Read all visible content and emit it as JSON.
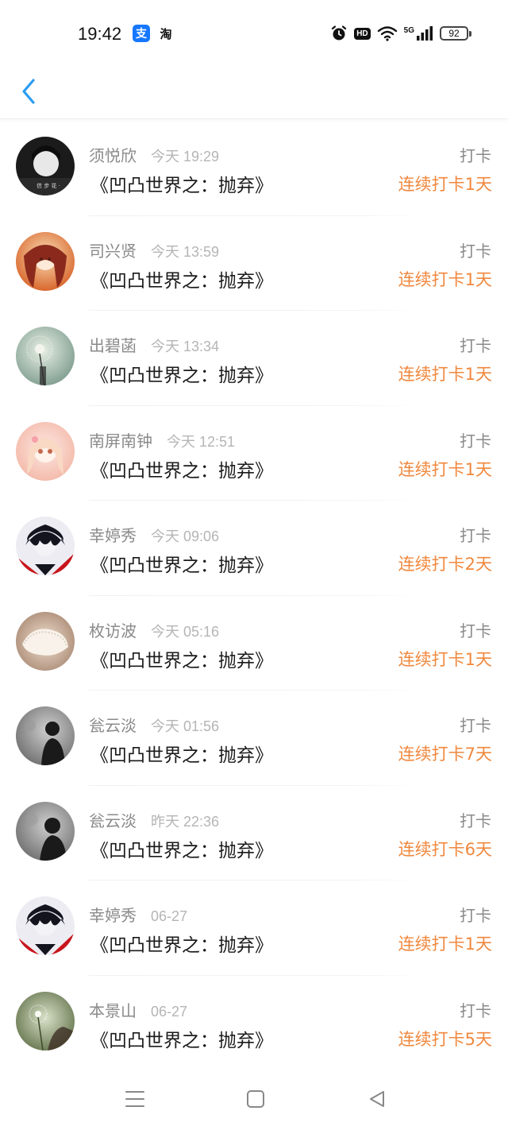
{
  "status_bar": {
    "time": "19:42",
    "app_badges": [
      {
        "icon": "alipay-icon",
        "glyph": "支",
        "color": "#1677ff"
      },
      {
        "icon": "taobao-icon",
        "glyph": "淘"
      }
    ],
    "hd_label": "HD",
    "network_label": "5G",
    "battery_level": "92"
  },
  "nav": {
    "back_icon": "chevron-left-icon",
    "accent_color": "#2c9cf2"
  },
  "theme": {
    "streak_color": "#f0883e",
    "muted_text": "#8a8a8a",
    "timestamp_text": "#b5b5b5"
  },
  "entries": [
    {
      "name": "须悦欣",
      "time": "今天 19:29",
      "book": "《凹凸世界之：抛弃》",
      "action": "打卡",
      "streak": "连续打卡1天",
      "avatar": "avatar-1"
    },
    {
      "name": "司兴贤",
      "time": "今天 13:59",
      "book": "《凹凸世界之：抛弃》",
      "action": "打卡",
      "streak": "连续打卡1天",
      "avatar": "avatar-2"
    },
    {
      "name": "出碧菡",
      "time": "今天 13:34",
      "book": "《凹凸世界之：抛弃》",
      "action": "打卡",
      "streak": "连续打卡1天",
      "avatar": "avatar-3"
    },
    {
      "name": "南屏南钟",
      "time": "今天 12:51",
      "book": "《凹凸世界之：抛弃》",
      "action": "打卡",
      "streak": "连续打卡1天",
      "avatar": "avatar-4"
    },
    {
      "name": "幸婷秀",
      "time": "今天 09:06",
      "book": "《凹凸世界之：抛弃》",
      "action": "打卡",
      "streak": "连续打卡2天",
      "avatar": "avatar-5"
    },
    {
      "name": "枚访波",
      "time": "今天 05:16",
      "book": "《凹凸世界之：抛弃》",
      "action": "打卡",
      "streak": "连续打卡1天",
      "avatar": "avatar-6"
    },
    {
      "name": "瓮云淡",
      "time": "今天 01:56",
      "book": "《凹凸世界之：抛弃》",
      "action": "打卡",
      "streak": "连续打卡7天",
      "avatar": "avatar-7"
    },
    {
      "name": "瓮云淡",
      "time": "昨天 22:36",
      "book": "《凹凸世界之：抛弃》",
      "action": "打卡",
      "streak": "连续打卡6天",
      "avatar": "avatar-8"
    },
    {
      "name": "幸婷秀",
      "time": "06-27",
      "book": "《凹凸世界之：抛弃》",
      "action": "打卡",
      "streak": "连续打卡1天",
      "avatar": "avatar-9"
    },
    {
      "name": "本景山",
      "time": "06-27",
      "book": "《凹凸世界之：抛弃》",
      "action": "打卡",
      "streak": "连续打卡5天",
      "avatar": "avatar-10"
    }
  ],
  "system_nav": [
    {
      "icon": "menu-icon"
    },
    {
      "icon": "home-square-icon"
    },
    {
      "icon": "back-triangle-icon"
    }
  ]
}
